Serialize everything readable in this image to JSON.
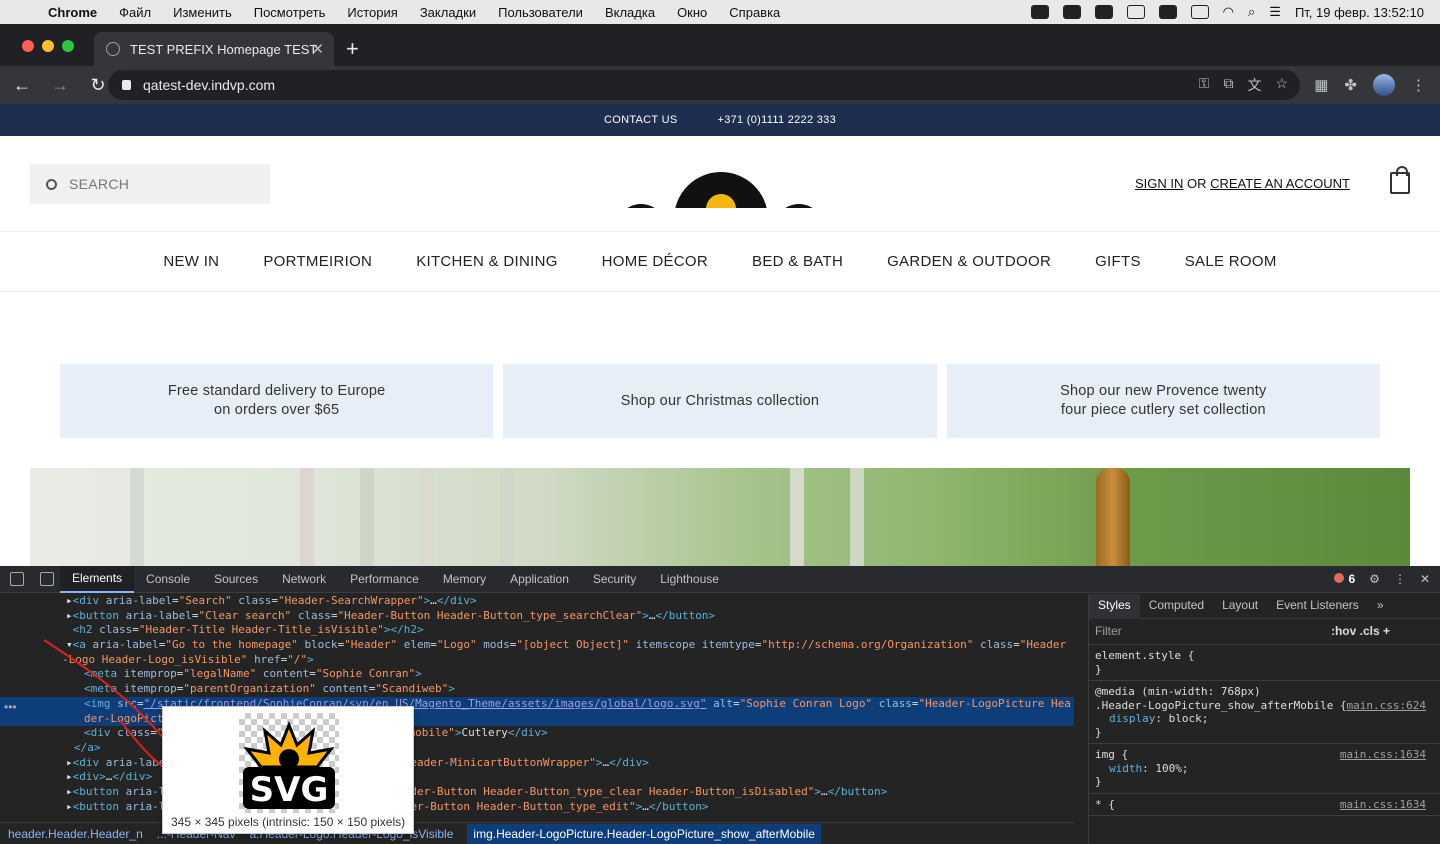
{
  "mac_menu": {
    "app": "Chrome",
    "items": [
      "Файл",
      "Изменить",
      "Посмотреть",
      "История",
      "Закладки",
      "Пользователи",
      "Вкладка",
      "Окно",
      "Справка"
    ],
    "clock": "Пт, 19 февр.  13:52:10"
  },
  "browser": {
    "tab_title": "TEST PREFIX Homepage TEST",
    "url": "qatest-dev.indvp.com"
  },
  "site": {
    "topbar": {
      "contact": "CONTACT US",
      "phone": "+371 (0)1111 2222 333"
    },
    "search_placeholder": "SEARCH",
    "account": {
      "sign_in": "SIGN IN",
      "or": "OR",
      "create": "CREATE AN ACCOUNT"
    },
    "nav": [
      "NEW IN",
      "PORTMEIRION",
      "KITCHEN & DINING",
      "HOME DÉCOR",
      "BED & BATH",
      "GARDEN & OUTDOOR",
      "GIFTS",
      "SALE ROOM"
    ],
    "promos": [
      "Free standard delivery to Europe\non orders over $65",
      "Shop our Christmas collection",
      "Shop our new Provence twenty\nfour piece cutlery set collection"
    ]
  },
  "devtools": {
    "tabs": [
      "Elements",
      "Console",
      "Sources",
      "Network",
      "Performance",
      "Memory",
      "Application",
      "Security",
      "Lighthouse"
    ],
    "error_count": "6",
    "styles_tabs": [
      "Styles",
      "Computed",
      "Layout",
      "Event Listeners"
    ],
    "filter_placeholder": "Filter",
    "filter_ops": ":hov  .cls  +",
    "tooltip_text": "345 × 345 pixels (intrinsic: 150 × 150 pixels)",
    "breadcrumbs": [
      "header.Header.Header_n",
      "...-Header-Nav",
      "a.Header-Logo.Header-Logo_isVisible",
      "img.Header-LogoPicture.Header-LogoPicture_show_afterMobile"
    ],
    "styles": {
      "element_style": "element.style {",
      "media": "@media (min-width: 768px)",
      "rule1_sel": ".Header-LogoPicture_show_afterMobile {",
      "rule1_prop": "display",
      "rule1_val": "block;",
      "rule1_src": "main.css:624",
      "rule2_sel": "img {",
      "rule2_prop": "width",
      "rule2_val": "100%;",
      "rule2_src": "main.css:1634",
      "rule3_sel": "* {",
      "rule3_src": "main.css:1634"
    }
  }
}
